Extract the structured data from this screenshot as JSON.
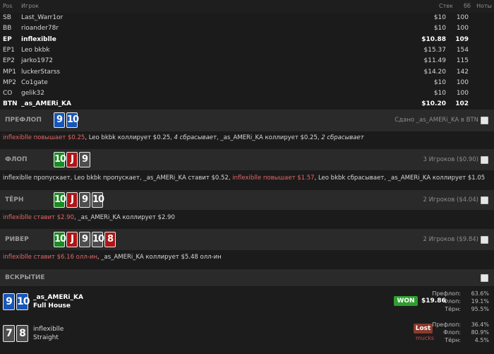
{
  "header": {
    "pos": "Pos",
    "player": "Игрок",
    "stack": "Стек",
    "bb": "бб",
    "notes": "Ноты"
  },
  "players": [
    {
      "pos": "SB",
      "name": "Last_Warr1or",
      "stack": "$10",
      "bb": "100",
      "bold": false
    },
    {
      "pos": "BB",
      "name": "rioander78r",
      "stack": "$10",
      "bb": "100",
      "bold": false
    },
    {
      "pos": "EP",
      "name": "inflexiblle",
      "stack": "$10.88",
      "bb": "109",
      "bold": true
    },
    {
      "pos": "EP1",
      "name": "Leo bkbk",
      "stack": "$15.37",
      "bb": "154",
      "bold": false
    },
    {
      "pos": "EP2",
      "name": "jarko1972",
      "stack": "$11.49",
      "bb": "115",
      "bold": false
    },
    {
      "pos": "MP1",
      "name": "luckerStarss",
      "stack": "$14.20",
      "bb": "142",
      "bold": false
    },
    {
      "pos": "MP2",
      "name": "Co1gate",
      "stack": "$10",
      "bb": "100",
      "bold": false
    },
    {
      "pos": "CO",
      "name": "gelik32",
      "stack": "$10",
      "bb": "100",
      "bold": false
    },
    {
      "pos": "BTN",
      "name": "_as_AMERi_KA",
      "stack": "$10.20",
      "bb": "102",
      "bold": true
    }
  ],
  "preflop": {
    "label": "ПРЕФЛОП",
    "cards": [
      {
        "rank": "9",
        "color": "blue"
      },
      {
        "rank": "10",
        "color": "blue"
      }
    ],
    "info": "Сдано _as_AMERi_KA в BTN",
    "actions": [
      {
        "text": "inflexiblle повышает $0.25",
        "style": "agg"
      },
      {
        "text": ", Leo bkbk коллирует $0.25, ",
        "style": ""
      },
      {
        "text": "4 сбрасывает",
        "style": "it"
      },
      {
        "text": ", _as_AMERi_KA коллирует $0.25, ",
        "style": ""
      },
      {
        "text": "2 сбрасывает",
        "style": "it"
      }
    ]
  },
  "flop": {
    "label": "ФЛОП",
    "cards": [
      {
        "rank": "10",
        "color": "green"
      },
      {
        "rank": "J",
        "color": "red"
      },
      {
        "rank": "9",
        "color": "gray"
      }
    ],
    "info": "3 Игроков ($0.90)",
    "actions": [
      {
        "text": "inflexiblle пропускает, Leo bkbk пропускает, _as_AMERi_KA ставит $0.52, ",
        "style": ""
      },
      {
        "text": "inflexiblle повышает $1.57",
        "style": "agg"
      },
      {
        "text": ", Leo bkbk сбрасывает, _as_AMERi_KA коллирует $1.05",
        "style": ""
      }
    ]
  },
  "turn": {
    "label": "ТЁРН",
    "cards": [
      {
        "rank": "10",
        "color": "green"
      },
      {
        "rank": "J",
        "color": "red"
      },
      {
        "rank": "9",
        "color": "gray"
      },
      {
        "rank": "10",
        "color": "gray"
      }
    ],
    "info": "2 Игроков ($4.04)",
    "actions": [
      {
        "text": "inflexiblle ставит $2.90",
        "style": "agg"
      },
      {
        "text": ", _as_AMERi_KA коллирует $2.90",
        "style": ""
      }
    ]
  },
  "river": {
    "label": "РИВЕР",
    "cards": [
      {
        "rank": "10",
        "color": "green"
      },
      {
        "rank": "J",
        "color": "red"
      },
      {
        "rank": "9",
        "color": "gray"
      },
      {
        "rank": "10",
        "color": "gray"
      },
      {
        "rank": "8",
        "color": "red"
      }
    ],
    "info": "2 Игроков ($9.84)",
    "actions": [
      {
        "text": "inflexiblle ставит $6.16 олл-ин",
        "style": "agg"
      },
      {
        "text": ", _as_AMERi_KA коллирует $5.48 олл-ин",
        "style": ""
      }
    ]
  },
  "showdown": {
    "label": "ВСКРЫТИЕ",
    "winner": {
      "cards": [
        {
          "rank": "9",
          "color": "blue"
        },
        {
          "rank": "10",
          "color": "blue"
        }
      ],
      "name": "_as_AMERi_KA",
      "hand": "Full House",
      "result": "WON",
      "amount": "$19.86",
      "equity": [
        {
          "k": "Префлоп:",
          "v": "63.6%"
        },
        {
          "k": "Флоп:",
          "v": "19.1%"
        },
        {
          "k": "Тёрн:",
          "v": "95.5%"
        }
      ]
    },
    "loser": {
      "cards": [
        {
          "rank": "7",
          "color": "gray"
        },
        {
          "rank": "8",
          "color": "gray"
        }
      ],
      "name": "inflexiblle",
      "hand": "Straight",
      "result": "Lost",
      "note": "mucks",
      "equity": [
        {
          "k": "Префлоп:",
          "v": "36.4%"
        },
        {
          "k": "Флоп:",
          "v": "80.9%"
        },
        {
          "k": "Тёрн:",
          "v": "4.5%"
        }
      ]
    }
  },
  "colors": {
    "aggressive": "#e56767",
    "won": "#2e9e2e",
    "lost": "#8a3a2c",
    "blue_card": "#1756b8",
    "green_card": "#1a8a22",
    "red_card": "#b01515"
  }
}
